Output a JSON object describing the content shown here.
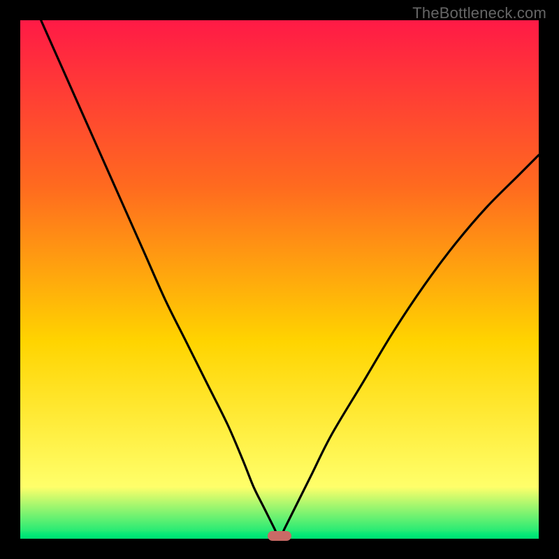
{
  "watermark": "TheBottleneck.com",
  "chart_data": {
    "type": "line",
    "title": "",
    "xlabel": "",
    "ylabel": "",
    "xlim": [
      0,
      100
    ],
    "ylim": [
      0,
      100
    ],
    "grid": false,
    "legend": false,
    "series": [
      {
        "name": "bottleneck-curve",
        "color": "#000000",
        "x": [
          4,
          8,
          12,
          16,
          20,
          24,
          28,
          32,
          36,
          40,
          43,
          45,
          47,
          49,
          50,
          51,
          53,
          56,
          60,
          66,
          72,
          78,
          84,
          90,
          96,
          100
        ],
        "y": [
          100,
          91,
          82,
          73,
          64,
          55,
          46,
          38,
          30,
          22,
          15,
          10,
          6,
          2,
          0,
          2,
          6,
          12,
          20,
          30,
          40,
          49,
          57,
          64,
          70,
          74
        ]
      }
    ],
    "marker": {
      "name": "optimal-point",
      "x": 50,
      "y": 0,
      "color": "#c96a66"
    },
    "background_gradient": {
      "top": "#ff1a46",
      "mid_upper": "#ff6a1f",
      "mid": "#ffd400",
      "mid_lower": "#ffff6a",
      "bottom": "#00e776"
    }
  }
}
